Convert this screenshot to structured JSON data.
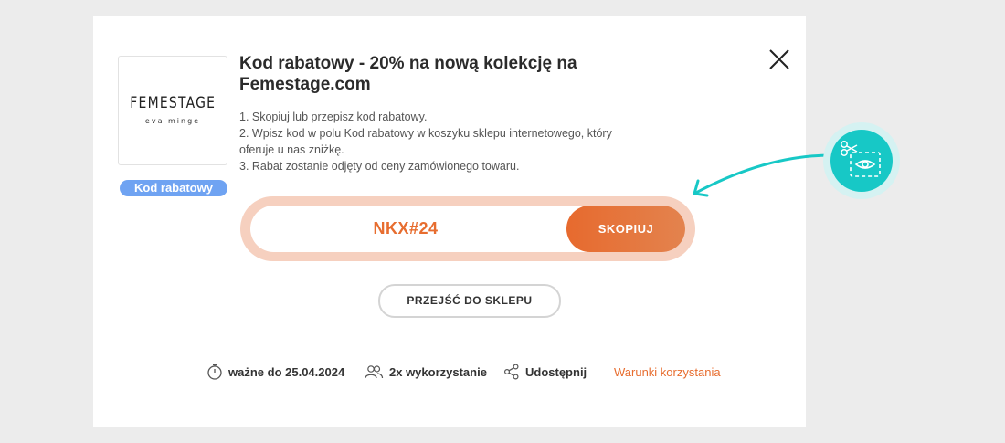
{
  "offer": {
    "logo_main": "FEMESTAGE",
    "logo_sub": "eva minge",
    "badge": "Kod rabatowy",
    "title": "Kod rabatowy - 20% na nową kolekcję na Femestage.com",
    "instructions": [
      "1. Skopiuj lub przepisz kod rabatowy.",
      "2. Wpisz kod w polu Kod rabatowy w koszyku sklepu internetowego, który oferuje u nas zniżkę.",
      "3. Rabat zostanie odjęty od ceny zamówionego towaru."
    ]
  },
  "code": {
    "value": "NKX#24",
    "copy_label": "SKOPIUJ"
  },
  "shop_button": "PRZEJŚĆ DO SKLEPU",
  "footer": {
    "valid": "ważne do 25.04.2024",
    "usage": "2x wykorzystanie",
    "share": "Udostępnij",
    "terms": "Warunki korzystania"
  },
  "icons": {
    "close": "close-icon",
    "timer": "stopwatch-icon",
    "users": "users-icon",
    "share": "share-icon",
    "coupon": "scissors-coupon-icon"
  },
  "colors": {
    "accent": "#e76d2f",
    "badge": "#6fa3f2",
    "teal": "#17c8c6"
  }
}
